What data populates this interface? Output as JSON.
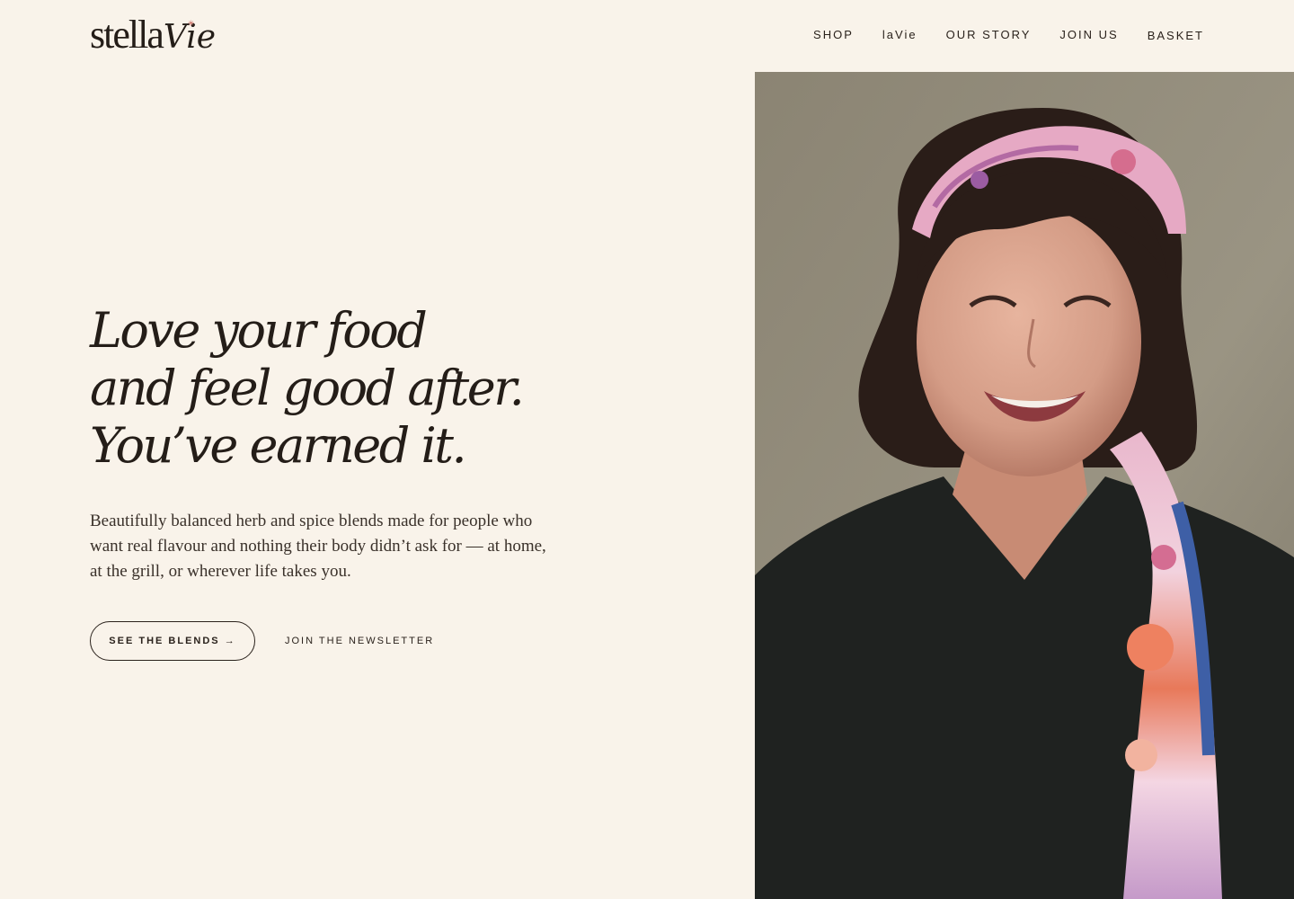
{
  "brand": {
    "wordmark": "stella",
    "wordmark_accent": "Vie",
    "star_glyph": "✳"
  },
  "nav": {
    "items": [
      {
        "label": "SHOP"
      },
      {
        "label": "laVie"
      },
      {
        "label": "OUR STORY"
      },
      {
        "label": "JOIN US"
      },
      {
        "label": "BASKET"
      }
    ]
  },
  "hero": {
    "title_lines": [
      "Love your food",
      "and feel good after.",
      "You’ve earned it."
    ],
    "body": "Beautifully balanced herb and spice blends made for people who want real flavour and nothing their body didn’t ask for — at home, at the grill, or wherever life takes you.",
    "cta_primary": "SEE THE BLENDS →",
    "cta_secondary": "JOIN THE NEWSLETTER"
  },
  "colors": {
    "background": "#f9f3ea",
    "text": "#2a221c",
    "accent": "#c2554a"
  }
}
